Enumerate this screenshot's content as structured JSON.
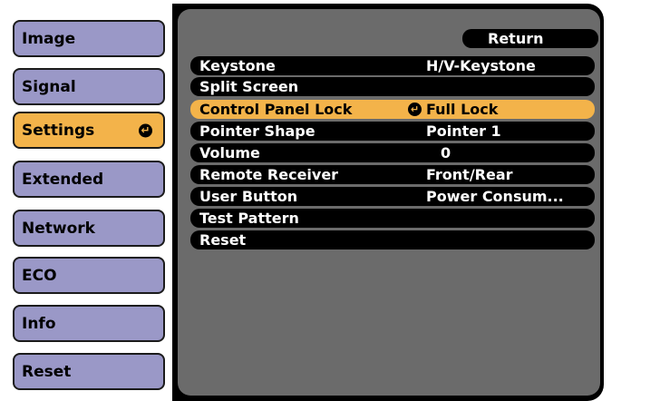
{
  "sidebar": {
    "items": [
      {
        "label": "Image"
      },
      {
        "label": "Signal"
      },
      {
        "label": "Settings",
        "active": true
      },
      {
        "label": "Extended"
      },
      {
        "label": "Network"
      },
      {
        "label": "ECO"
      },
      {
        "label": "Info"
      },
      {
        "label": "Reset"
      }
    ]
  },
  "content": {
    "return_label": "Return",
    "rows": [
      {
        "label": "Keystone",
        "value": "H/V-Keystone"
      },
      {
        "label": "Split Screen",
        "value": ""
      },
      {
        "label": "Control Panel Lock",
        "value": "Full Lock",
        "selected": true
      },
      {
        "label": "Pointer Shape",
        "value": "Pointer 1"
      },
      {
        "label": "Volume",
        "value": "0"
      },
      {
        "label": "Remote Receiver",
        "value": "Front/Rear"
      },
      {
        "label": "User Button",
        "value": "Power Consum..."
      },
      {
        "label": "Test Pattern",
        "value": ""
      },
      {
        "label": "Reset",
        "value": ""
      }
    ]
  },
  "colors": {
    "tab": "#9a98c7",
    "active": "#f3b34a",
    "panel": "#6b6b6b",
    "frame": "#000000"
  },
  "icons": {
    "enter": "enter-icon"
  }
}
